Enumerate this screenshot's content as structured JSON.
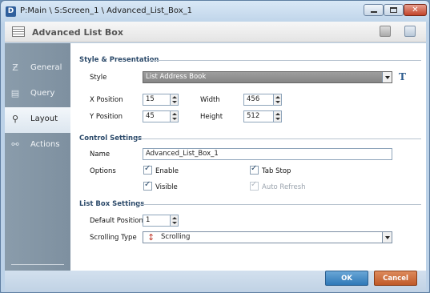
{
  "window": {
    "app_icon": "D",
    "title": "P:Main \\ S:Screen_1 \\ Advanced_List_Box_1"
  },
  "header": {
    "title": "Advanced List Box",
    "icon": "list-box-icon"
  },
  "sidebar": {
    "items": [
      {
        "label": "General",
        "icon": "general-icon",
        "active": false
      },
      {
        "label": "Query",
        "icon": "query-icon",
        "active": false
      },
      {
        "label": "Layout",
        "icon": "layout-icon",
        "active": true
      },
      {
        "label": "Actions",
        "icon": "actions-icon",
        "active": false
      }
    ]
  },
  "style_presentation": {
    "heading": "Style & Presentation",
    "style_label": "Style",
    "style_value": "List Address Book",
    "t_icon": "T",
    "x_label": "X Position",
    "x_value": "15",
    "y_label": "Y Position",
    "y_value": "45",
    "width_label": "Width",
    "width_value": "456",
    "height_label": "Height",
    "height_value": "512"
  },
  "control_settings": {
    "heading": "Control Settings",
    "name_label": "Name",
    "name_value": "Advanced_List_Box_1",
    "options_label": "Options",
    "enable_label": "Enable",
    "enable_checked": true,
    "tab_stop_label": "Tab Stop",
    "tab_stop_checked": true,
    "visible_label": "Visible",
    "visible_checked": true,
    "auto_refresh_label": "Auto Refresh",
    "auto_refresh_checked": true,
    "auto_refresh_disabled": true
  },
  "list_box_settings": {
    "heading": "List Box Settings",
    "default_position_label": "Default Position",
    "default_position_value": "1",
    "scrolling_type_label": "Scrolling Type",
    "scrolling_type_value": "Scrolling"
  },
  "footer": {
    "ok_label": "OK",
    "cancel_label": "Cancel"
  },
  "colors": {
    "ok_button": "#2f79b8",
    "cancel_button": "#c05a28",
    "sidebar": "#8a9cab",
    "section_heading": "#2d4b6b"
  }
}
